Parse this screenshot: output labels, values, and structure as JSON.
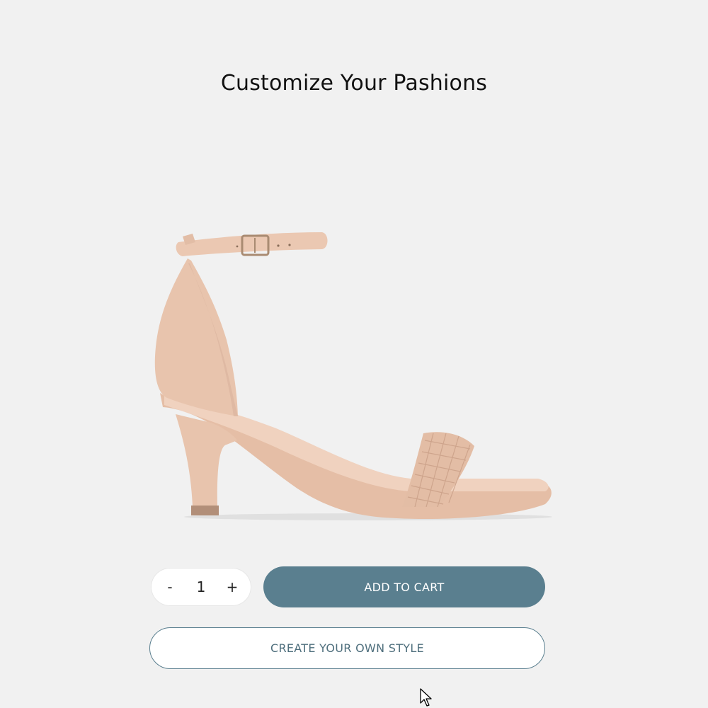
{
  "header": {
    "title": "Customize Your Pashions"
  },
  "product": {
    "image_icon": "high-heel-sandal",
    "color": "#e8c4ad"
  },
  "quantity": {
    "decrement_label": "-",
    "value": "1",
    "increment_label": "+"
  },
  "actions": {
    "add_to_cart_label": "ADD TO CART",
    "create_style_label": "CREATE YOUR OWN STYLE"
  },
  "colors": {
    "background": "#f1f1f1",
    "accent": "#5a7f8f"
  }
}
